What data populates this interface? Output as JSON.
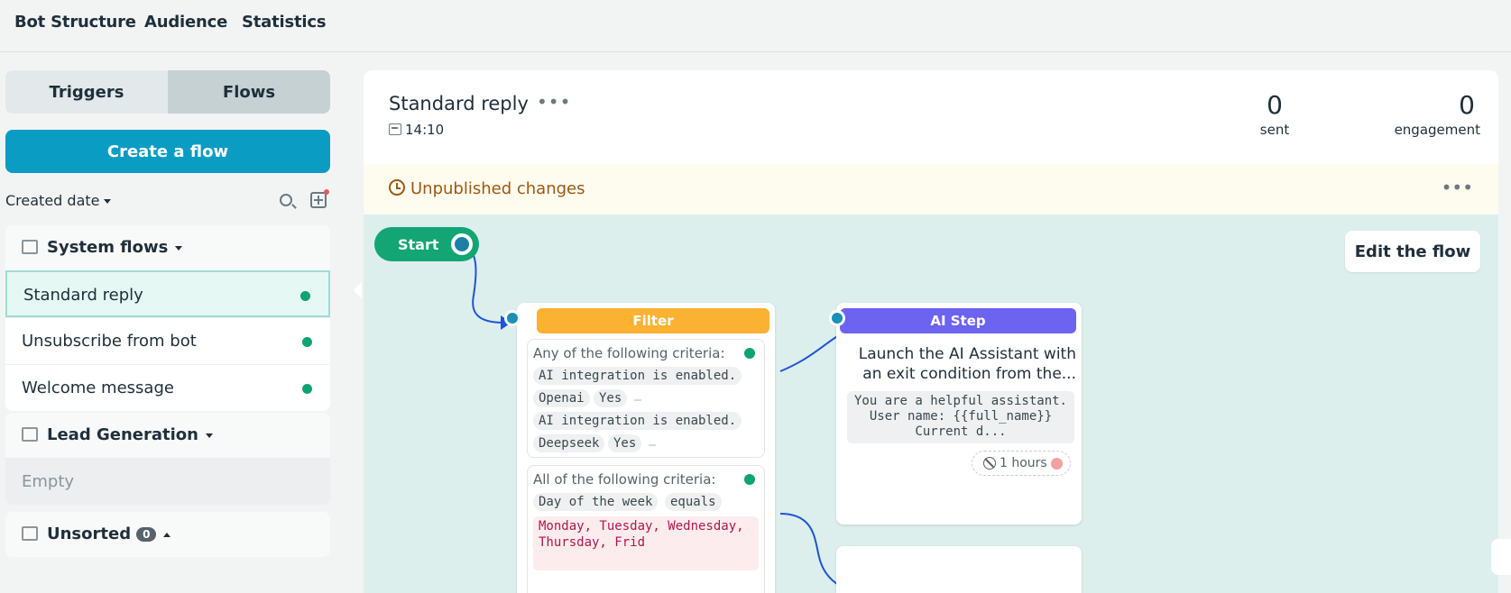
{
  "topnav": {
    "items": [
      "Bot Structure",
      "Audience",
      "Statistics"
    ]
  },
  "sidebar": {
    "tabs": [
      {
        "label": "Triggers"
      },
      {
        "label": "Flows"
      }
    ],
    "create_label": "Create a flow",
    "sort_label": "Created date",
    "groups": [
      {
        "title": "System flows",
        "items": [
          {
            "label": "Standard reply"
          },
          {
            "label": "Unsubscribe from bot"
          },
          {
            "label": "Welcome message"
          }
        ]
      },
      {
        "title": "Lead Generation",
        "empty_label": "Empty"
      },
      {
        "title": "Unsorted",
        "count": "0"
      }
    ]
  },
  "flow": {
    "title": "Standard reply",
    "time": "14:10"
  },
  "stats": [
    {
      "value": "0",
      "label": "sent"
    },
    {
      "value": "0",
      "label": "engagement"
    }
  ],
  "banner": {
    "message": "Unpublished changes"
  },
  "canvas": {
    "start_label": "Start",
    "edit_label": "Edit the flow",
    "filter": {
      "header": "Filter",
      "header_color": "#fbb131",
      "criteria_any": {
        "heading": "Any of the following criteria:",
        "rows": [
          {
            "condition": "AI integration is enabled.",
            "provider": "Openai",
            "value": "Yes"
          },
          {
            "condition": "AI integration is enabled.",
            "provider": "Deepseek",
            "value": "Yes"
          }
        ]
      },
      "criteria_all": {
        "heading": "All of the following criteria:",
        "field": "Day of the week",
        "operator": "equals",
        "days": "Monday, Tuesday, Wednesday, Thursday, Frid"
      }
    },
    "ai_step": {
      "header": "AI Step",
      "header_color": "#6c63f0",
      "description": "Launch the AI Assistant with an exit condition from the...",
      "prompt": "You are a helpful assistant. User name: {{full_name}} Current d...",
      "timer": "1 hours"
    }
  },
  "colors": {
    "primary": "#0a9cc3",
    "success": "#0ea372",
    "warning_text": "#9c5810",
    "wire": "#1f53d6"
  }
}
